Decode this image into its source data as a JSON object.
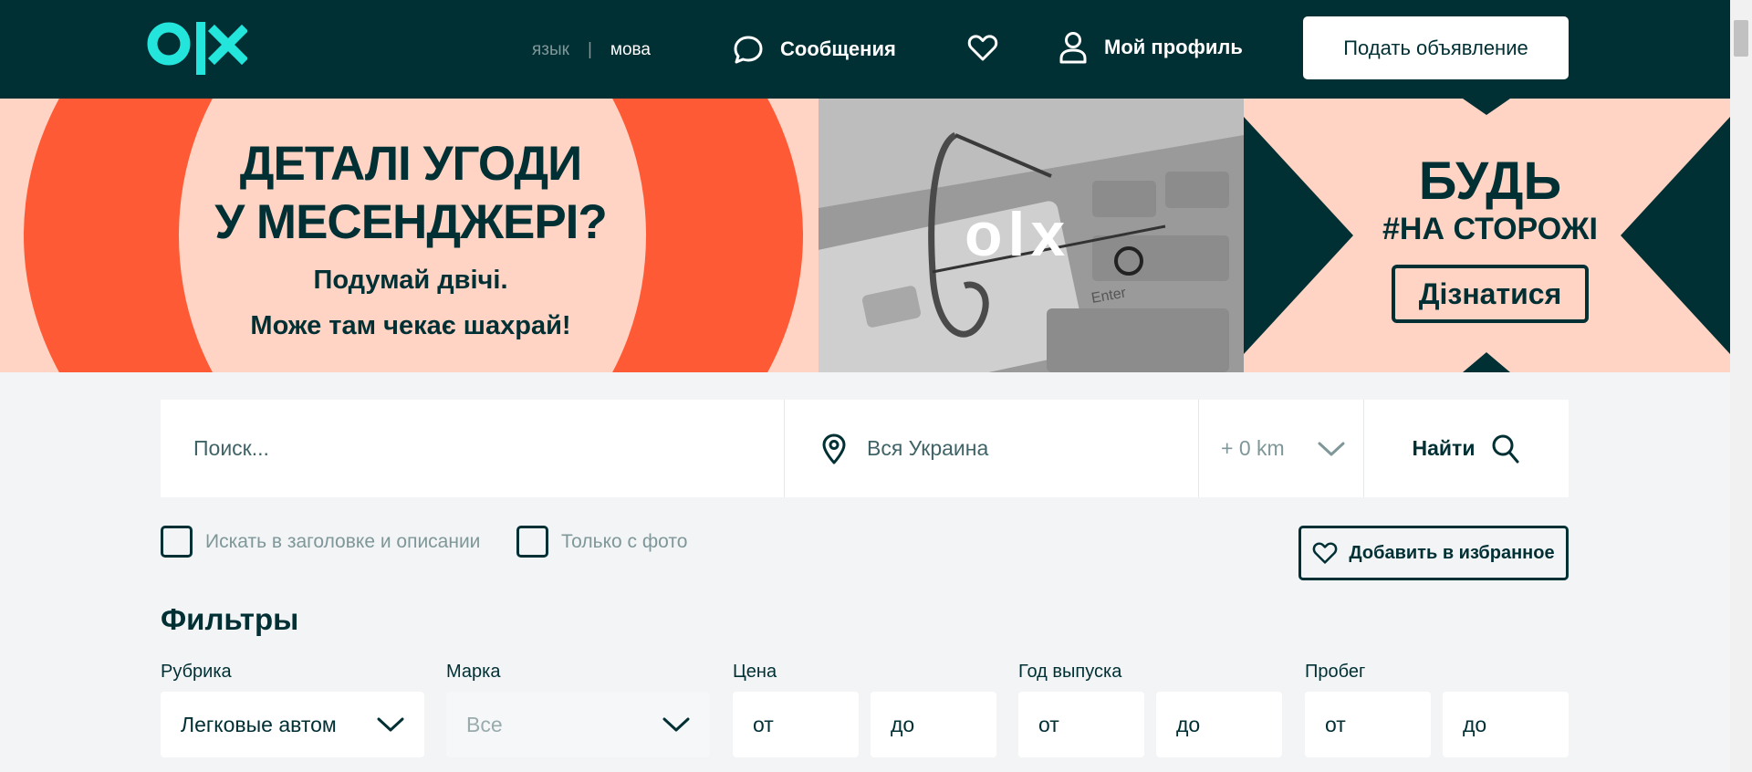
{
  "header": {
    "logo_text": "OLX",
    "lang_inactive": "язык",
    "lang_separator": "|",
    "lang_active": "мова",
    "messages_label": "Сообщения",
    "profile_label": "Мой профиль",
    "post_button": "Подать объявление",
    "background_color": "#002f34",
    "accent_color": "#23e5db"
  },
  "banner": {
    "left_title_line1": "ДЕТАЛІ УГОДИ",
    "left_title_line2": "У МЕСЕНДЖЕРІ?",
    "left_sub_line1": "Подумай двічі.",
    "left_sub_line2": "Може там чекає шахрай!",
    "center_logo": "olx",
    "keyboard_label": "Enter",
    "right_title": "БУДЬ",
    "right_subtitle": "#НА СТОРОЖІ",
    "right_cta": "Дізнатися"
  },
  "search": {
    "query_placeholder": "Поиск...",
    "query_value": "",
    "location_value": "Вся Украина",
    "radius_value": "+ 0 km",
    "submit_label": "Найти"
  },
  "options": {
    "search_in_description": "Искать в заголовке и описании",
    "photo_only": "Только с фото",
    "add_favorite": "Добавить в избранное"
  },
  "filters": {
    "title": "Фильтры",
    "category_label": "Рубрика",
    "category_value": "Легковые автом",
    "brand_label": "Марка",
    "brand_value": "Все",
    "price_label": "Цена",
    "year_label": "Год выпуска",
    "mileage_label": "Пробег",
    "from_placeholder": "от",
    "to_placeholder": "до"
  }
}
